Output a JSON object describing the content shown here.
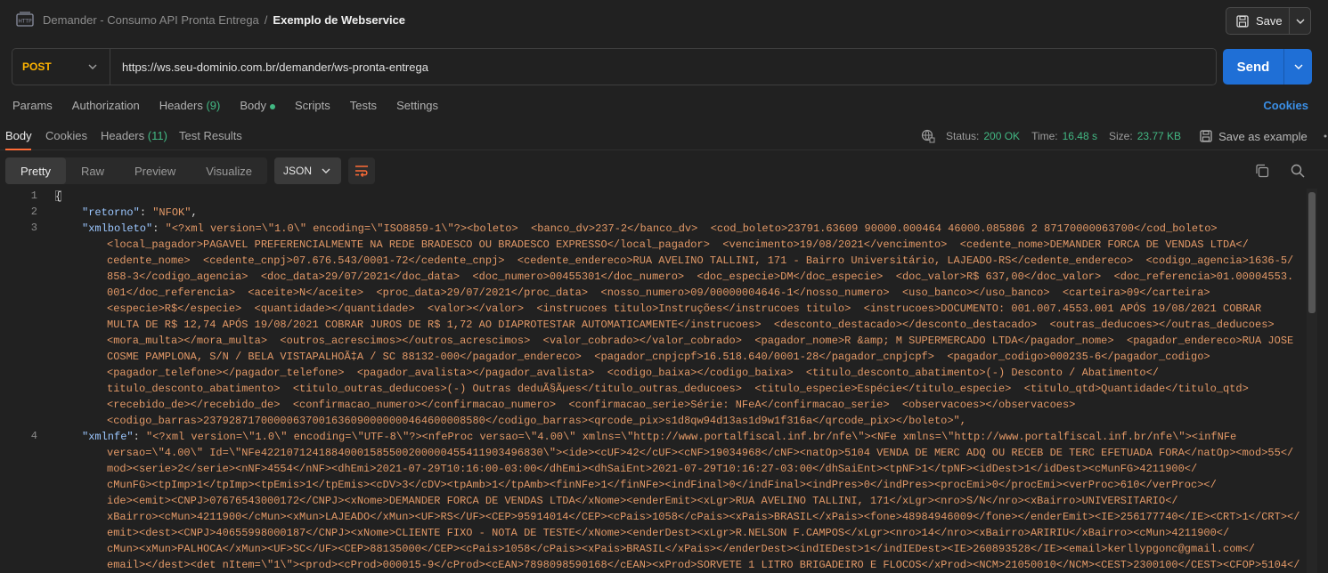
{
  "header": {
    "collection": "Demander - Consumo API Pronta Entrega",
    "separator": "/",
    "request_name": "Exemplo de Webservice",
    "save_label": "Save"
  },
  "request": {
    "method": "POST",
    "url": "https://ws.seu-dominio.com.br/demander/ws-pronta-entrega",
    "send_label": "Send"
  },
  "request_tabs": {
    "params": "Params",
    "authorization": "Authorization",
    "headers": "Headers",
    "headers_count": "(9)",
    "body": "Body",
    "scripts": "Scripts",
    "tests": "Tests",
    "settings": "Settings",
    "cookies": "Cookies"
  },
  "response_tabs": {
    "body": "Body",
    "cookies": "Cookies",
    "headers": "Headers",
    "headers_count": "(11)",
    "test_results": "Test Results"
  },
  "response_meta": {
    "status_label": "Status:",
    "status_value": "200 OK",
    "time_label": "Time:",
    "time_value": "16.48 s",
    "size_label": "Size:",
    "size_value": "23.77 KB",
    "save_example": "Save as example"
  },
  "viewer": {
    "pretty": "Pretty",
    "raw": "Raw",
    "preview": "Preview",
    "visualize": "Visualize",
    "format": "JSON"
  },
  "code": {
    "line_numbers": [
      "1",
      "2",
      "3",
      "4"
    ],
    "brace": "{",
    "l2_key": "\"retorno\"",
    "l2_val": "\"NFOK\"",
    "l3_key": "\"xmlboleto\"",
    "l4_key": "\"xmlnfe\"",
    "xmlboleto_lines": [
      "\"<?xml version=\\\"1.0\\\" encoding=\\\"ISO8859-1\\\"?><boleto>  <banco_dv>237-2</banco_dv>  <cod_boleto>23791.63609 90000.000464 46000.085806 2 87170000063700</cod_boleto>",
      "<local_pagador>PAGAVEL PREFERENCIALMENTE NA REDE BRADESCO OU BRADESCO EXPRESSO</local_pagador>  <vencimento>19/08/2021</vencimento>  <cedente_nome>DEMANDER FORCA DE VENDAS LTDA</",
      "cedente_nome>  <cedente_cnpj>07.676.543/0001-72</cedente_cnpj>  <cedente_endereco>RUA AVELINO TALLINI, 171 - Bairro Universitário, LAJEADO-RS</cedente_endereco>  <codigo_agencia>1636-5/",
      "858-3</codigo_agencia>  <doc_data>29/07/2021</doc_data>  <doc_numero>00455301</doc_numero>  <doc_especie>DM</doc_especie>  <doc_valor>R$ 637,00</doc_valor>  <doc_referencia>01.00004553.",
      "001</doc_referencia>  <aceite>N</aceite>  <proc_data>29/07/2021</proc_data>  <nosso_numero>09/00000004646-1</nosso_numero>  <uso_banco></uso_banco>  <carteira>09</carteira>",
      "<especie>R$</especie>  <quantidade></quantidade>  <valor></valor>  <instrucoes titulo>Instruções</instrucoes titulo>  <instrucoes>DOCUMENTO: 001.007.4553.001 APÓS 19/08/2021 COBRAR",
      "MULTA DE R$ 12,74 APÓS 19/08/2021 COBRAR JUROS DE R$ 1,72 AO DIAPROTESTAR AUTOMATICAMENTE</instrucoes>  <desconto_destacado></desconto_destacado>  <outras_deducoes></outras_deducoes>",
      "<mora_multa></mora_multa>  <outros_acrescimos></outros_acrescimos>  <valor_cobrado></valor_cobrado>  <pagador_nome>R &amp; M SUPERMERCADO LTDA</pagador_nome>  <pagador_endereco>RUA JOSE",
      "COSME PAMPLONA, S/N / BELA VISTAPALHOÃ‡A / SC 88132-000</pagador_endereco>  <pagador_cnpjcpf>16.518.640/0001-28</pagador_cnpjcpf>  <pagador_codigo>000235-6</pagador_codigo>",
      "<pagador_telefone></pagador_telefone>  <pagador_avalista></pagador_avalista>  <codigo_baixa></codigo_baixa>  <titulo_desconto_abatimento>(-) Desconto / Abatimento</",
      "titulo_desconto_abatimento>  <titulo_outras_deducoes>(-) Outras deduÃ§Ãµes</titulo_outras_deducoes>  <titulo_especie>Espécie</titulo_especie>  <titulo_qtd>Quantidade</titulo_qtd>",
      "<recebido_de></recebido_de>  <confirmacao_numero></confirmacao_numero>  <confirmacao_serie>Série: NFeA</confirmacao_serie>  <observacoes></observacoes>",
      "<codigo_barras>23792871700000637001636090000000464600008580</codigo_barras><qrcode_pix>s1d8qw94d13as1d9w1f316a</qrcode_pix></boleto>\","
    ],
    "xmlnfe_lines": [
      "\"<?xml version=\\\"1.0\\\" encoding=\\\"UTF-8\\\"?><nfeProc versao=\\\"4.00\\\" xmlns=\\\"http://www.portalfiscal.inf.br/nfe\\\"><NFe xmlns=\\\"http://www.portalfiscal.inf.br/nfe\\\"><infNFe",
      "versao=\\\"4.00\\\" Id=\\\"NFe42210712418840001585500200000455411903496830\\\"><ide><cUF>42</cUF><cNF>19034968</cNF><natOp>5104 VENDA DE MERC ADQ OU RECEB DE TERC EFETUADA FORA</natOp><mod>55</",
      "mod><serie>2</serie><nNF>4554</nNF><dhEmi>2021-07-29T10:16:00-03:00</dhEmi><dhSaiEnt>2021-07-29T10:16:27-03:00</dhSaiEnt><tpNF>1</tpNF><idDest>1</idDest><cMunFG>4211900</",
      "cMunFG><tpImp>1</tpImp><tpEmis>1</tpEmis><cDV>3</cDV><tpAmb>1</tpAmb><finNFe>1</finNFe><indFinal>0</indFinal><indPres>0</indPres><procEmi>0</procEmi><verProc>610</verProc></",
      "ide><emit><CNPJ>07676543000172</CNPJ><xNome>DEMANDER FORCA DE VENDAS LTDA</xNome><enderEmit><xLgr>RUA AVELINO TALLINI, 171</xLgr><nro>S/N</nro><xBairro>UNIVERSITARIO</",
      "xBairro><cMun>4211900</cMun><xMun>LAJEADO</xMun><UF>RS</UF><CEP>95914014</CEP><cPais>1058</cPais><xPais>BRASIL</xPais><fone>48984946009</fone></enderEmit><IE>256177740</IE><CRT>1</CRT></",
      "emit><dest><CNPJ>40655998000187</CNPJ><xNome>CLIENTE FIXO - NOTA DE TESTE</xNome><enderDest><xLgr>R.NELSON F.CAMPOS</xLgr><nro>14</nro><xBairro>ARIRIU</xBairro><cMun>4211900</",
      "cMun><xMun>PALHOCA</xMun><UF>SC</UF><CEP>88135000</CEP><cPais>1058</cPais><xPais>BRASIL</xPais></enderDest><indIEDest>1</indIEDest><IE>260893528</IE><email>kerllypgonc@gmail.com</",
      "email></dest><det nItem=\\\"1\\\"><prod><cProd>000015-9</cProd><cEAN>7898098590168</cEAN><xProd>SORVETE 1 LITRO BRIGADEIRO E FLOCOS</xProd><NCM>21050010</NCM><CEST>2300100</CEST><CFOP>5104</"
    ]
  }
}
